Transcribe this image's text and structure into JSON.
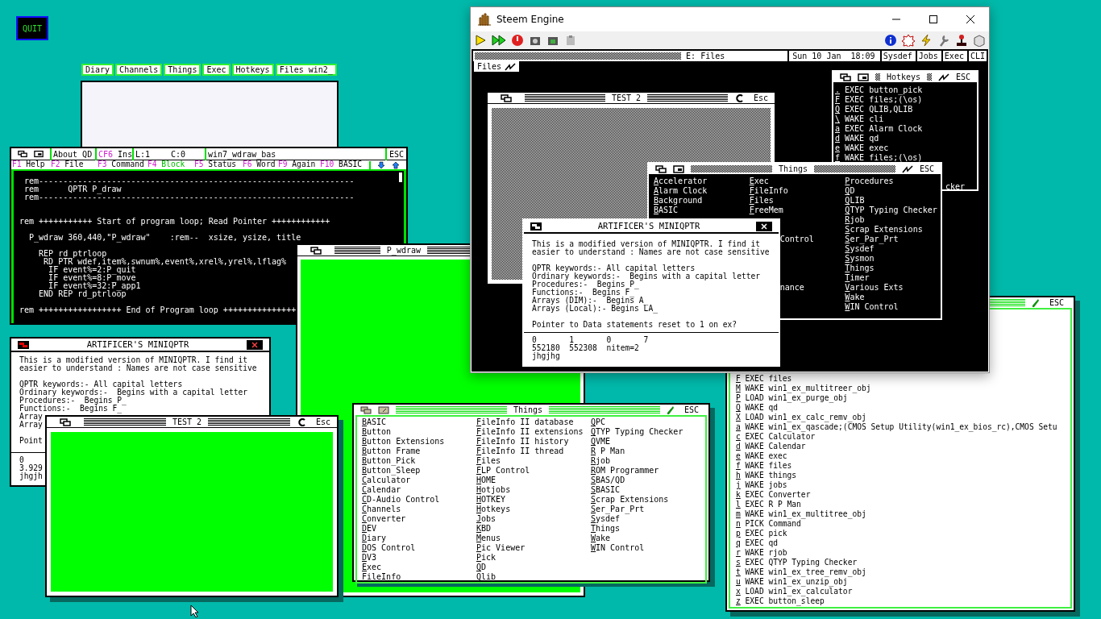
{
  "quit_button": "QUIT",
  "launcher_tabs": [
    "Diary",
    "Channels",
    "Things",
    "Exec",
    "Hotkeys",
    "Files win2_"
  ],
  "editor": {
    "about": "About QD",
    "mode_key": "CF6",
    "mode": "Ins",
    "line": "L:1",
    "column": "C:0",
    "filename": "win7_wdraw_bas",
    "escape": "ESC",
    "function_keys": [
      {
        "key": "F1",
        "label": "Help",
        "highlighted": false
      },
      {
        "key": "F2",
        "label": "File",
        "highlighted": false
      },
      {
        "key": "F3",
        "label": "Command",
        "highlighted": false
      },
      {
        "key": "F4",
        "label": "Block",
        "highlighted": true
      },
      {
        "key": "F5",
        "label": "Status",
        "highlighted": false
      },
      {
        "key": "F6",
        "label": "Word",
        "highlighted": false
      },
      {
        "key": "F9",
        "label": "Again",
        "highlighted": false
      },
      {
        "key": "F10",
        "label": "BASIC",
        "highlighted": false
      }
    ],
    "lines": [
      {
        "kind": "code",
        "text": " rem-----------------------------------------------------------------"
      },
      {
        "kind": "code",
        "text": " rem      QPTR P_draw"
      },
      {
        "kind": "code",
        "text": " rem-----------------------------------------------------------------"
      },
      {
        "kind": "blank"
      },
      {
        "kind": "blank"
      },
      {
        "kind": "code",
        "text": "rem +++++++++++ Start of program loop; Read Pointer ++++++++++++"
      },
      {
        "kind": "blank"
      },
      {
        "kind": "code",
        "text": "  P_wdraw 360,440,\"P_wdraw\"    :rem--  xsize, ysize, title"
      },
      {
        "kind": "blank"
      },
      {
        "kind": "code",
        "text": "    REP rd_ptrloop"
      },
      {
        "kind": "code",
        "text": "     RD_PTR wdef,item%,swnum%,event%,xrel%,yrel%,lflag%"
      },
      {
        "kind": "code",
        "text": "      IF event%=2:P_quit"
      },
      {
        "kind": "code",
        "text": "      IF event%=8:P_move"
      },
      {
        "kind": "code",
        "text": "      IF event%=32:P_app1"
      },
      {
        "kind": "code",
        "text": "    END REP rd_ptrloop"
      },
      {
        "kind": "blank"
      },
      {
        "kind": "code",
        "text": "rem +++++++++++++++++ End of Program loop +++++++++++++++"
      }
    ]
  },
  "miniqptr_left": {
    "title": "ARTIFICER'S MINIQPTR",
    "lines": [
      {
        "kind": "code",
        "text": "This is a modified version of MINIQPTR. I find it"
      },
      {
        "kind": "code",
        "text": "easier to understand : Names are not case sensitive"
      },
      {
        "kind": "blank"
      },
      {
        "kind": "code",
        "text": "QPTR keywords:- All capital letters"
      },
      {
        "kind": "code",
        "text": "Ordinary keywords:-  Begins with a capital letter"
      },
      {
        "kind": "code",
        "text": "Procedures:-  Begins P_"
      },
      {
        "kind": "code",
        "text": "Functions:-  Begins F_"
      },
      {
        "kind": "code",
        "text": "Array"
      },
      {
        "kind": "code",
        "text": "Array"
      },
      {
        "kind": "blank"
      },
      {
        "kind": "code",
        "text": "Point"
      }
    ],
    "footer": [
      "0",
      "3.929",
      "jhgjh"
    ]
  },
  "pwdraw_window": {
    "title": "P_wdraw"
  },
  "test2_left": {
    "title": "TEST 2",
    "escape": "Esc"
  },
  "things_window": {
    "title": "Things",
    "escape": "ESC",
    "columns": [
      [
        "BASIC",
        "Button",
        "Button Extensions",
        "Button Frame",
        "Button_Pick",
        "Button_Sleep",
        "Calculator",
        "Calendar",
        "CD-Audio Control",
        "Channels",
        "Converter",
        "DEV",
        "Diary",
        "DOS Control",
        "DV3",
        "Exec",
        "FileInfo"
      ],
      [
        "FileInfo II database",
        "FileInfo II extensions",
        "FileInfo II history",
        "FileInfo II thread",
        "Files",
        "FLP Control",
        "HOME",
        "Hotjobs",
        "HOTKEY",
        "Hotkeys",
        "Jobs",
        "KBD",
        "Menus",
        "Pic Viewer",
        "Pick",
        "QD",
        "Qlib"
      ],
      [
        "QPC",
        "QTYP Typing Checker",
        "QVME",
        "R P Man",
        "Rjob",
        "ROM Programmer",
        "SBAS/QD",
        "SBASIC",
        "Scrap Extensions",
        "Ser_Par_Prt",
        "Sysdef",
        "Things",
        "Wake",
        "WIN Control"
      ]
    ]
  },
  "hotkeys_window": {
    "escape": "ESC",
    "items": [
      {
        "key": "F",
        "action": "EXEC files"
      },
      {
        "key": "M",
        "action": "WAKE win1_ex_multitreer_obj"
      },
      {
        "key": "P",
        "action": "LOAD win1_ex_purge_obj"
      },
      {
        "key": "Q",
        "action": "WAKE qd"
      },
      {
        "key": "X",
        "action": "LOAD win1_ex_calc_remv_obj"
      },
      {
        "key": "a",
        "action": "WAKE win1_ex_qascade;(CMOS Setup Utility(win1_ex_bios_rc),CMOS Setu"
      },
      {
        "key": "c",
        "action": "EXEC Calculator"
      },
      {
        "key": "d",
        "action": "WAKE Calendar"
      },
      {
        "key": "e",
        "action": "WAKE exec"
      },
      {
        "key": "f",
        "action": "WAKE files"
      },
      {
        "key": "h",
        "action": "WAKE things"
      },
      {
        "key": "j",
        "action": "WAKE jobs"
      },
      {
        "key": "k",
        "action": "EXEC Converter"
      },
      {
        "key": "l",
        "action": "EXEC R P Man"
      },
      {
        "key": "m",
        "action": "WAKE win1_ex_multitree_obj"
      },
      {
        "key": "n",
        "action": "PICK Command"
      },
      {
        "key": "p",
        "action": "EXEC pick"
      },
      {
        "key": "q",
        "action": "EXEC qd"
      },
      {
        "key": "r",
        "action": "WAKE rjob"
      },
      {
        "key": "s",
        "action": "EXEC QTYP Typing Checker"
      },
      {
        "key": "t",
        "action": "WAKE win1_ex_tree_remv_obj"
      },
      {
        "key": "u",
        "action": "WAKE win1_ex_unzip_obj"
      },
      {
        "key": "x",
        "action": "LOAD win1_ex_calculator"
      },
      {
        "key": "z",
        "action": "EXEC button_sleep"
      }
    ]
  },
  "emulator": {
    "title": "Steem Engine",
    "status_bar": {
      "drive": "E: Files",
      "date": "Sun 10 Jan  18:09",
      "buttons": [
        "Sysdef",
        "Jobs",
        "Exec",
        "CLI"
      ]
    },
    "files_tab": "Files",
    "test2": {
      "title": "TEST 2",
      "escape": "Esc"
    },
    "hotkeys": {
      "title": "Hotkeys",
      "escape": "ESC",
      "items": [
        {
          "key": ".",
          "action": "EXEC button_pick"
        },
        {
          "key": "F",
          "action": "EXEC files;(\\os)"
        },
        {
          "key": "Q",
          "action": "EXEC QLIB,QLIB"
        },
        {
          "key": "\\",
          "action": "WAKE cli"
        },
        {
          "key": "a",
          "action": "EXEC Alarm Clock"
        },
        {
          "key": "d",
          "action": "WAKE qd"
        },
        {
          "key": "e",
          "action": "WAKE exec"
        },
        {
          "key": "f",
          "action": "WAKE files;(\\os)"
        }
      ],
      "partial_line": "cker"
    },
    "things": {
      "title": "Things",
      "escape": "ESC",
      "columns": [
        [
          {
            "kind": "item",
            "text": "Accelerator"
          },
          {
            "kind": "item",
            "text": "Alarm Clock"
          },
          {
            "kind": "item",
            "text": "Background"
          },
          {
            "kind": "item",
            "text": "BASIC"
          }
        ],
        [
          {
            "kind": "item",
            "text": "Exec"
          },
          {
            "kind": "item",
            "text": "FileInfo"
          },
          {
            "kind": "item",
            "text": "Files"
          },
          {
            "kind": "item",
            "text": "FreeMem"
          },
          {
            "kind": "gap"
          },
          {
            "kind": "gap"
          },
          {
            "kind": "fragment",
            "text": "Control"
          },
          {
            "kind": "gap"
          },
          {
            "kind": "gap"
          },
          {
            "kind": "gap"
          },
          {
            "kind": "gap"
          },
          {
            "kind": "fragment",
            "text": "nance"
          }
        ],
        [
          {
            "kind": "item",
            "text": "Procedures"
          },
          {
            "kind": "item",
            "text": "QD"
          },
          {
            "kind": "item",
            "text": "QLIB"
          },
          {
            "kind": "item",
            "text": "QTYP Typing Checker"
          },
          {
            "kind": "item",
            "text": "Rjob"
          },
          {
            "kind": "item",
            "text": "Scrap Extensions"
          },
          {
            "kind": "item",
            "text": "Ser_Par_Prt"
          },
          {
            "kind": "item",
            "text": "Sysdef"
          },
          {
            "kind": "item",
            "text": "Sysmon"
          },
          {
            "kind": "item",
            "text": "Things"
          },
          {
            "kind": "item",
            "text": "Timer"
          },
          {
            "kind": "item",
            "text": "Various Exts"
          },
          {
            "kind": "item",
            "text": "Wake"
          },
          {
            "kind": "item",
            "text": "WIN Control"
          }
        ]
      ]
    },
    "dialog": {
      "title": "ARTIFICER'S MINIQPTR",
      "lines": [
        {
          "kind": "code",
          "text": "This is a modified version of MINIQPTR. I find it"
        },
        {
          "kind": "code",
          "text": "easier to understand : Names are not case sensitive"
        },
        {
          "kind": "blank"
        },
        {
          "kind": "code",
          "text": "QPTR keywords:- All capital letters"
        },
        {
          "kind": "code",
          "text": "Ordinary keywords:-  Begins with a capital letter"
        },
        {
          "kind": "code",
          "text": "Procedures:-  Begins P_"
        },
        {
          "kind": "code",
          "text": "Functions:-  Begins F_"
        },
        {
          "kind": "code",
          "text": "Arrays (DIM):-  Begins A_"
        },
        {
          "kind": "code",
          "text": "Arrays (Local):- Begins LA_"
        },
        {
          "kind": "blank"
        },
        {
          "kind": "code",
          "text": "Pointer to Data statements reset to 1 on ex?"
        }
      ],
      "footer": [
        "0       1       0       7",
        "552180  552308  nitem=2",
        "jhgjhg"
      ]
    }
  }
}
